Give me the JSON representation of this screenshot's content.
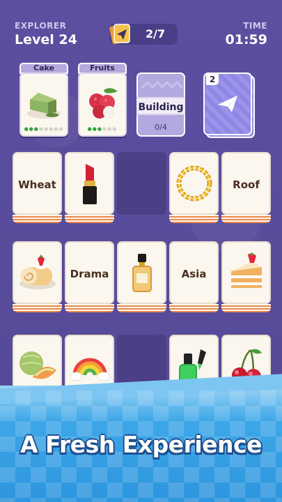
{
  "header": {
    "mode_label": "EXPLORER",
    "level_text": "Level 24",
    "progress_text": "2/7",
    "time_label": "TIME",
    "time_value": "01:59"
  },
  "collection": {
    "slots": [
      {
        "category": "Cake",
        "icon": "cake-slice-icon",
        "progress": 3,
        "total": 8
      },
      {
        "category": "Fruits",
        "icon": "lychee-icon",
        "progress": 3,
        "total": 6
      }
    ],
    "building": {
      "label": "Building",
      "count_text": "0/4"
    },
    "deck": {
      "remaining": "2",
      "icon": "paper-plane-icon"
    }
  },
  "board": {
    "row1": [
      "Wheat",
      "lipstick-icon",
      "empty",
      "gold-chain-icon",
      "Roof"
    ],
    "row2": [
      "cake-roll-icon",
      "Drama",
      "perfume-icon",
      "Asia",
      "cake-slice-icon"
    ],
    "row3": [
      "melon-icon",
      "rainbow-icon",
      "empty",
      "nail-polish-icon",
      "cherries-icon"
    ],
    "word_labels": {
      "wheat": "Wheat",
      "roof": "Roof",
      "drama": "Drama",
      "asia": "Asia"
    }
  },
  "banner": {
    "tagline": "A Fresh Experience"
  },
  "colors": {
    "background": "#5b4d9c",
    "accent_orange": "#e9894a",
    "banner_blue": "#3ea7e8"
  }
}
